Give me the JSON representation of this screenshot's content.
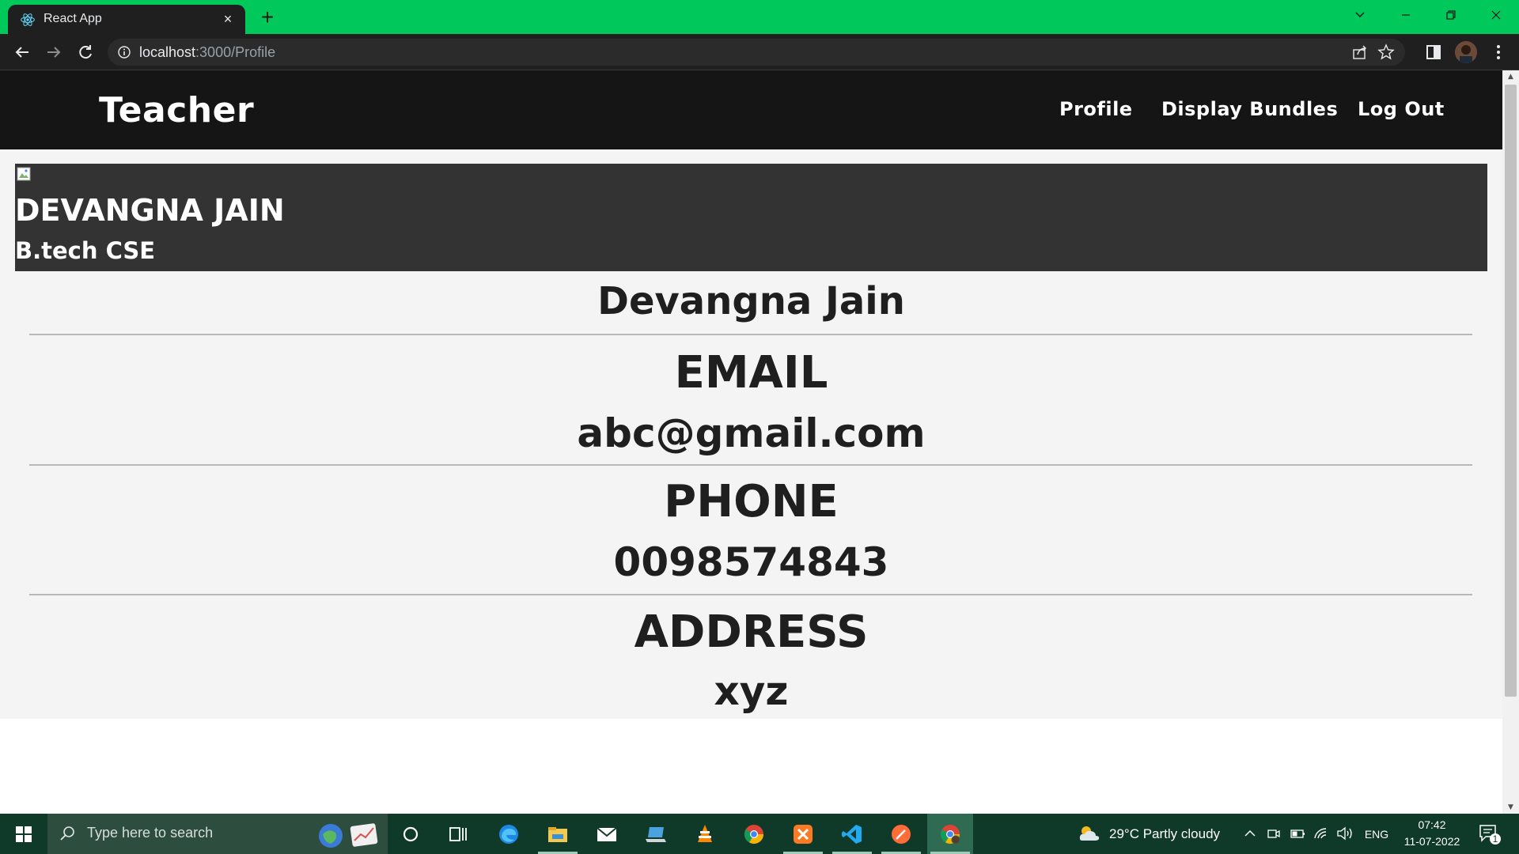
{
  "browser": {
    "tab_title": "React App",
    "tab_close": "×",
    "new_tab": "+",
    "url_host": "localhost",
    "url_path": ":3000/Profile"
  },
  "app": {
    "brand": "Teacher",
    "nav": [
      {
        "label": "Profile"
      },
      {
        "label": "Display Bundles"
      },
      {
        "label": "Log Out"
      }
    ]
  },
  "profile": {
    "header_name": "DEVANGNA JAIN",
    "course": "B.tech CSE",
    "full_name": "Devangna Jain",
    "email_label": "EMAIL",
    "email": "abc@gmail.com",
    "phone_label": "PHONE",
    "phone": "0098574843",
    "address_label": "ADDRESS",
    "address": "xyz"
  },
  "taskbar": {
    "search_placeholder": "Type here to search",
    "weather": "29°C  Partly cloudy",
    "language": "ENG",
    "time": "07:42",
    "date": "11-07-2022",
    "notification_count": "1"
  },
  "colors": {
    "tabstrip": "#00c85a",
    "navbar": "#151515",
    "profile_header": "#333333",
    "page_bg": "#f4f4f4",
    "taskbar": "#0f3a2a"
  }
}
